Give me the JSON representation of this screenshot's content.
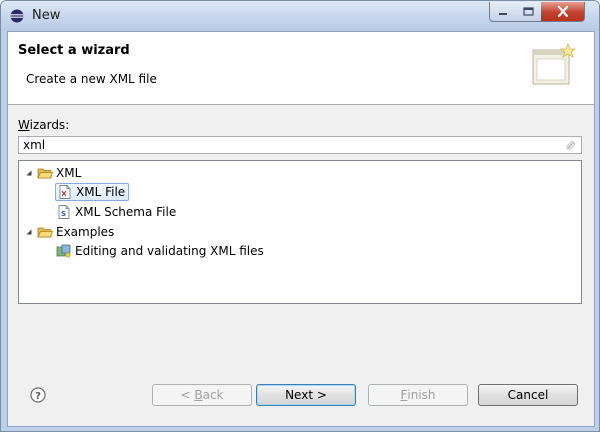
{
  "window": {
    "title": "New"
  },
  "header": {
    "title": "Select a wizard",
    "subtitle": "Create a new XML file"
  },
  "wizards": {
    "label_mnemonic": "W",
    "label_rest": "izards:",
    "search_value": "xml"
  },
  "tree": {
    "categories": [
      {
        "label": "XML",
        "items": [
          "XML File",
          "XML Schema File"
        ]
      },
      {
        "label": "Examples",
        "items": [
          "Editing and validating XML files"
        ]
      }
    ],
    "selected": "XML File"
  },
  "buttons": {
    "back_prefix": "< ",
    "back_mnemonic": "B",
    "back_rest": "ack",
    "next": "Next >",
    "finish_mnemonic": "F",
    "finish_rest": "inish",
    "cancel": "Cancel"
  },
  "colors": {
    "title_bar": "#c6d7ec",
    "close_button": "#c3432d",
    "selection_border": "#84acdd",
    "folder": "#e7b84a"
  }
}
